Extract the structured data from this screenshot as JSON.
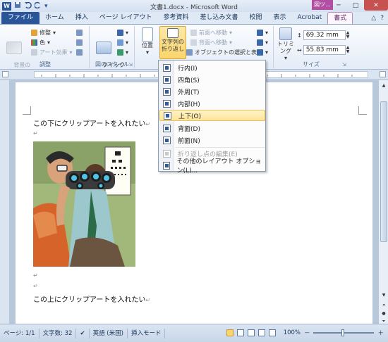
{
  "window": {
    "title": "文書1.docx - Microsoft Word",
    "app_logo": "W",
    "context_tab_header": "図ツ...",
    "minimize": "─",
    "maximize": "□",
    "close": "✕"
  },
  "qat": {
    "save_icon": "save-icon",
    "undo_icon": "undo-icon",
    "redo_icon": "redo-icon"
  },
  "tabs": [
    "ファイル",
    "ホーム",
    "挿入",
    "ページ レイアウト",
    "参考資料",
    "差し込み文書",
    "校閲",
    "表示",
    "Acrobat",
    "書式"
  ],
  "ribbon": {
    "bg_remove": "背景の\n削除",
    "corrections": "修整",
    "color": "色",
    "art_effects": "アート効果",
    "group_adjust": "調整",
    "quick_style": "クイック\nスタイル",
    "group_picture_style": "図のスタイル",
    "position": "位置",
    "wrap_text": "文字列の\n折り返し",
    "bring_forward": "前面へ移動",
    "send_backward": "背面へ移動",
    "selection_pane": "オブジェクトの選択と表示",
    "crop": "トリミング",
    "height": "69.32 mm",
    "width": "55.83 mm",
    "group_size": "サイズ"
  },
  "wrap_menu": {
    "items": [
      {
        "label": "行内(I)",
        "enabled": true
      },
      {
        "label": "四角(S)",
        "enabled": true
      },
      {
        "label": "外周(T)",
        "enabled": true
      },
      {
        "label": "内部(H)",
        "enabled": true
      },
      {
        "label": "上下(O)",
        "enabled": true,
        "highlighted": true
      },
      {
        "label": "背面(D)",
        "enabled": true
      },
      {
        "label": "前面(N)",
        "enabled": true
      },
      {
        "label": "折り返し点の編集(E)",
        "enabled": false
      },
      {
        "label": "その他のレイアウト オプション(L)...",
        "enabled": true
      }
    ]
  },
  "document": {
    "line1": "この下にクリップアートを入れたい",
    "line2": "この上にクリップアートを入れたい",
    "para_mark": "↵"
  },
  "status": {
    "page": "ページ: 1/1",
    "words": "文字数: 32",
    "language": "英語 (米国)",
    "mode": "挿入モード",
    "zoom": "100%",
    "zoom_minus": "－",
    "zoom_plus": "＋"
  },
  "colors": {
    "file_tab": "#2a5699",
    "context_purple": "#b24fa3",
    "highlight": "#fde59a"
  }
}
